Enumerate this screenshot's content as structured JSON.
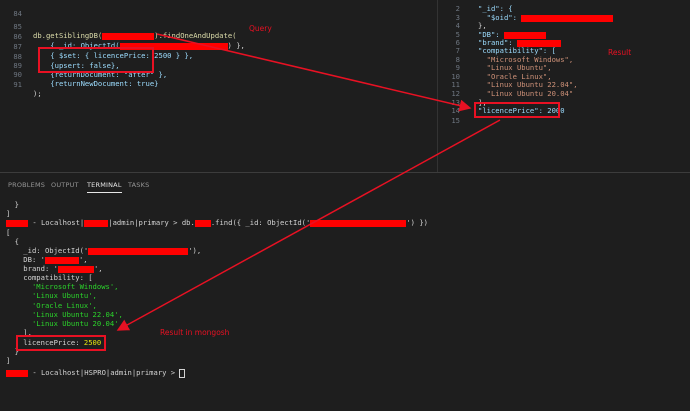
{
  "editor_left": {
    "line_84": "84",
    "line_85": "85",
    "line_86": "86",
    "line_87": "87",
    "line_88": "88",
    "line_89": "89",
    "line_90": "90",
    "line_91": "91",
    "code_85_a": "db.getSiblingDB(",
    "code_85_b": ").findOneAndUpdate(",
    "code_86_a": "    { _id: ObjectId(",
    "code_86_b": ") },",
    "code_87": "    { $set: { licencePrice: 2500 } },",
    "code_88": "    {upsert: false},",
    "code_89": "    {returnDocument: \"after\" },",
    "code_90": "    {returnNewDocument: true}",
    "code_91": ");"
  },
  "editor_right": {
    "line_2": "2",
    "line_3": "3",
    "line_4": "4",
    "line_5": "5",
    "line_6": "6",
    "line_7": "7",
    "line_8": "8",
    "line_9": "9",
    "line_10": "10",
    "line_11": "11",
    "line_12": "12",
    "line_13": "13",
    "line_14": "14",
    "line_15": "15",
    "code_2": "\"_id\": {",
    "code_3": "  \"$oid\": ",
    "code_4": "},",
    "code_5": "\"DB\": ",
    "code_6": "\"brand\": ",
    "code_7": "\"compatibility\": [",
    "code_8": "  \"Microsoft Windows\",",
    "code_9": "  \"Linux Ubuntu\",",
    "code_10": "  \"Oracle Linux\",",
    "code_11": "  \"Linux Ubuntu 22.04\",",
    "code_12": "  \"Linux Ubuntu 20.04\"",
    "code_13": "],",
    "code_14": "\"licencePrice\": 2000",
    "code_15": ""
  },
  "annotations": {
    "query": "Query",
    "result": "Result",
    "result_mongosh": "Result in mongosh"
  },
  "panel_tabs": {
    "problems": "PROBLEMS",
    "output": "OUTPUT",
    "terminal": "TERMINAL",
    "tasks": "TASKS"
  },
  "terminal": {
    "t1": "  }",
    "t2": "]",
    "t3_a": " - Localhost|",
    "t3_b": "|admin|primary > db.",
    "t3_c": ".find({ _id: ObjectId('",
    "t3_d": "') })",
    "t4": "[",
    "t5": "  {",
    "t6_a": "    _id: ObjectId('",
    "t6_b": "'),",
    "t7_a": "    DB: '",
    "t7_b": "',",
    "t8_a": "    brand: '",
    "t8_b": "',",
    "t9": "    compatibility: [",
    "t10": "      'Microsoft Windows',",
    "t11": "      'Linux Ubuntu',",
    "t12": "      'Oracle Linux',",
    "t13": "      'Linux Ubuntu 22.04',",
    "t14": "      'Linux Ubuntu 20.04'",
    "t15": "    ],",
    "t16_a": "    licencePrice: ",
    "t16_b": "2500",
    "t17": "  }",
    "t18": "]",
    "t19_a": " - Localhost|HSPRO|admin|primary > "
  },
  "colors": {
    "highlight_red": "#e81123",
    "background": "#1e1e1e"
  }
}
